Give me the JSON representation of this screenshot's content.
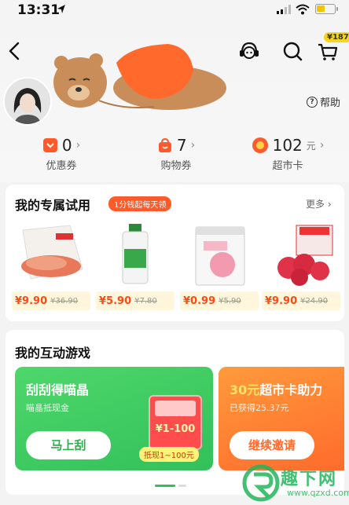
{
  "status_bar": {
    "time": "13:31"
  },
  "header": {
    "cart_badge": "¥187",
    "help_label": "帮助"
  },
  "assets": [
    {
      "value": "0",
      "unit": "",
      "label": "优惠券",
      "icon": "coupon-icon",
      "color": "#ff5a2c"
    },
    {
      "value": "7",
      "unit": "",
      "label": "购物券",
      "icon": "shopping-bag-icon",
      "color": "#ff5a2c"
    },
    {
      "value": "102",
      "unit": "元",
      "label": "超市卡",
      "icon": "supermarket-card-icon",
      "color": "#ff5a2c"
    }
  ],
  "trial": {
    "title": "我的专属试用",
    "tag": "1分钱起每天领",
    "more": "更多",
    "products": [
      {
        "price": "¥9.90",
        "original": "¥36.90",
        "image": "dried-pork-snack"
      },
      {
        "price": "¥5.90",
        "original": "¥7.80",
        "image": "disinfectant-bottle"
      },
      {
        "price": "¥0.99",
        "original": "¥5.90",
        "image": "candy-pack"
      },
      {
        "price": "¥9.90",
        "original": "¥24.90",
        "image": "freeze-dried-strawberry"
      }
    ]
  },
  "games": {
    "title": "我的互动游戏",
    "game1": {
      "title": "刮刮得喵晶",
      "subtitle": "喵晶抵现金",
      "amount": "¥1-100",
      "cash_tag": "抵现1~100元",
      "button": "马上刮"
    },
    "game2": {
      "title_prefix": "30元",
      "title_rest": "超市卡助力",
      "subtitle": "已获得25.37元",
      "button": "继续邀请"
    }
  },
  "watermark": {
    "text": "趣下网",
    "url": "www.qzxd.com"
  },
  "colors": {
    "accent": "#ff5a2c",
    "green": "#33c05a",
    "orange": "#ff6b2c"
  }
}
